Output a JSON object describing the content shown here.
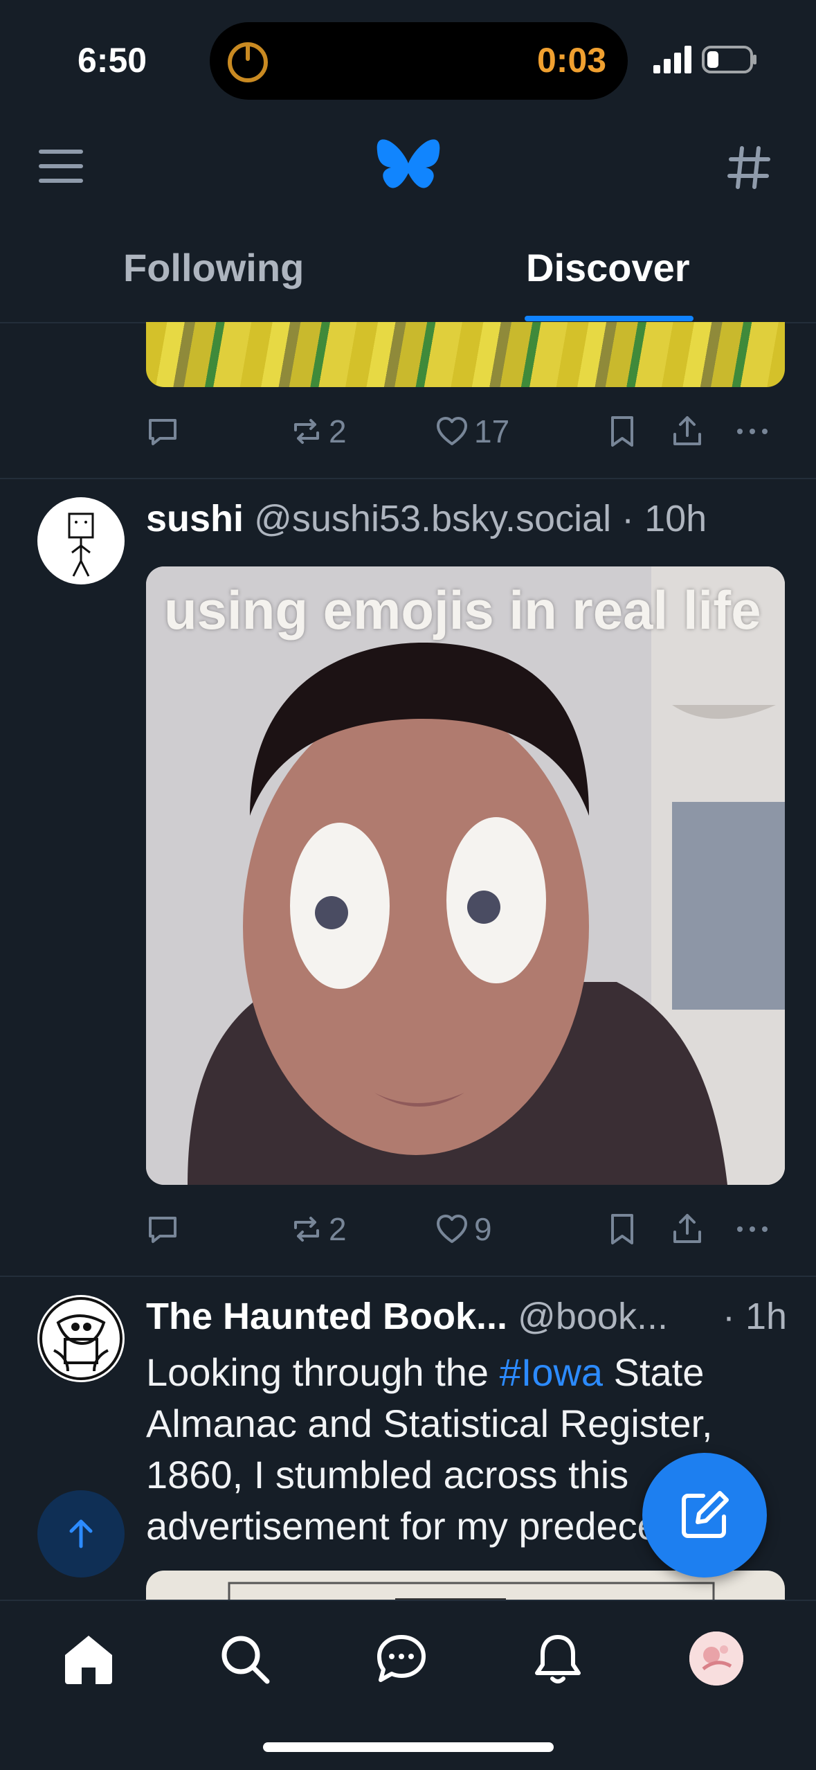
{
  "status_bar": {
    "time": "6:50",
    "island_timer": "0:03",
    "icons": [
      "timer-icon",
      "signal-icon",
      "battery-icon"
    ]
  },
  "header": {
    "icons": [
      "menu-icon",
      "butterfly-logo-icon",
      "hashtag-icon"
    ],
    "tabs": [
      {
        "label": "Following",
        "active": false
      },
      {
        "label": "Discover",
        "active": true
      }
    ]
  },
  "feed": {
    "posts": [
      {
        "partial": true,
        "reply_count": "",
        "repost_count": "2",
        "like_count": "17"
      },
      {
        "author": "sushi",
        "handle": "@sushi53.bsky.social",
        "time": "· 10h",
        "image_caption": "using emojis in real life",
        "reply_count": "",
        "repost_count": "2",
        "like_count": "9"
      },
      {
        "author": "The Haunted Book...",
        "handle": "@book...",
        "time": "· 1h",
        "text_before": "Looking through the ",
        "hashtag": "#Iowa",
        "text_after": " State Almanac and Statistical Register, 1860, I stumbled across this advertisement for my predecessor:"
      }
    ]
  },
  "bottom_nav": {
    "items": [
      "home-icon",
      "search-icon",
      "chat-icon",
      "notifications-icon",
      "profile-avatar"
    ]
  },
  "colors": {
    "background": "#161e27",
    "accent": "#1083fe",
    "muted": "#788698"
  }
}
